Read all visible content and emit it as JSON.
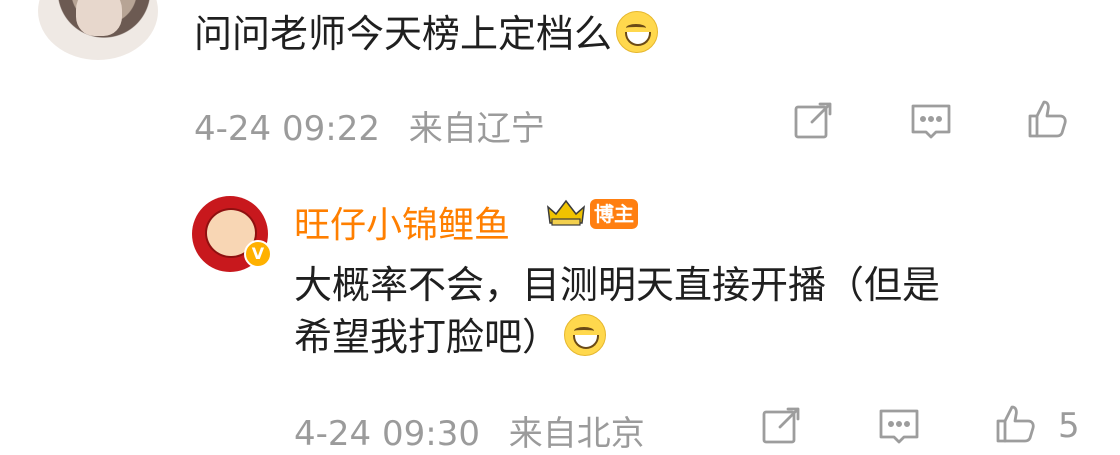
{
  "comment": {
    "text": "问问老师今天榜上定档么",
    "date": "4-24 09:22",
    "location": "来自辽宁"
  },
  "reply": {
    "username": "旺仔小锦鲤鱼",
    "badge": "博主",
    "avatar_badge": "V",
    "text_line1": "大概率不会，目测明天直接开播（但是",
    "text_line2": "希望我打脸吧）",
    "date": "4-24 09:30",
    "location": "来自北京",
    "like_count": "5"
  },
  "colors": {
    "username": "#ff7f00",
    "meta": "#9b9b9b",
    "badge": "#ff7f11"
  }
}
